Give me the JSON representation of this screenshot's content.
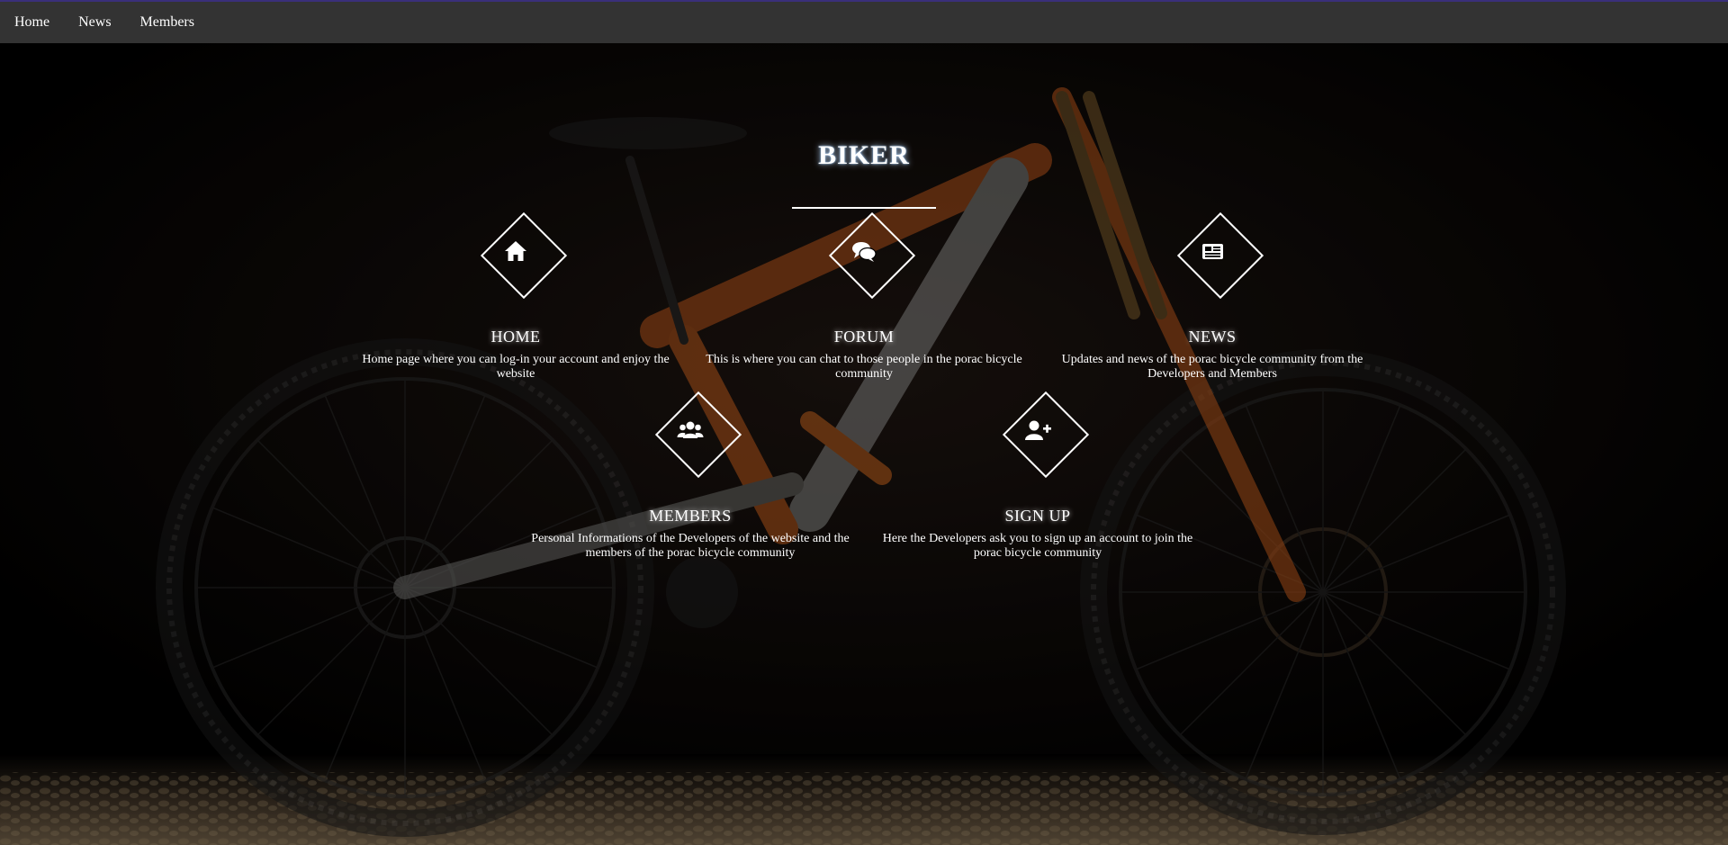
{
  "nav": {
    "items": [
      {
        "label": "Home"
      },
      {
        "label": "News"
      },
      {
        "label": "Members"
      }
    ]
  },
  "hero": {
    "title": "BIKER"
  },
  "features": [
    {
      "title": "HOME",
      "icon": "home-icon",
      "description": "Home page where you can log-in your account and enjoy the website"
    },
    {
      "title": "FORUM",
      "icon": "chat-icon",
      "description": "This is where you can chat to those people in the porac bicycle community"
    },
    {
      "title": "NEWS",
      "icon": "newspaper-icon",
      "description": "Updates and news of the porac bicycle community from the Developers and Members"
    },
    {
      "title": "MEMBERS",
      "icon": "users-icon",
      "description": "Personal Informations of the Developers of the website and the members of the porac bicycle community"
    },
    {
      "title": "SIGN UP",
      "icon": "user-plus-icon",
      "description": "Here the Developers ask you to sign up an account to join the porac bicycle community"
    }
  ],
  "colors": {
    "topbar": "#333333",
    "topbar_accent": "#3a2f7a",
    "bike_orange": "#d9661e",
    "background": "#000000"
  }
}
